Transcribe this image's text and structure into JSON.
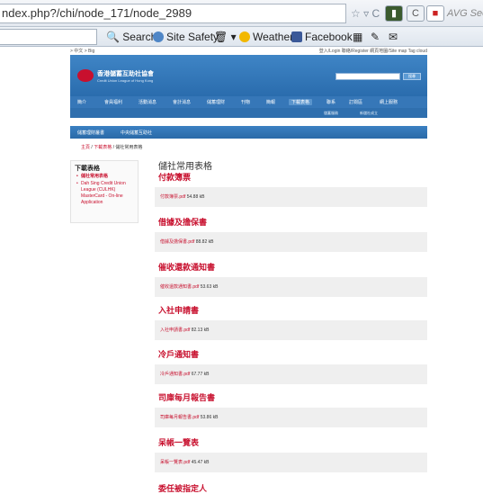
{
  "browser": {
    "url": "ndex.php?/chi/node_171/node_2989",
    "avg_label": "AVG Secu",
    "search_label": "Search",
    "toolbar": [
      {
        "label": "Site Safety",
        "icon": "site-safety-icon"
      },
      {
        "label": "Weather",
        "icon": "weather-icon"
      },
      {
        "label": "Facebook",
        "icon": "facebook-icon"
      }
    ]
  },
  "site": {
    "topline_left": "> 中文 > Big",
    "topline_right": "登入/Login   聯絡/Register   網頁地圖/Site map   Tag cloud",
    "logo_name": "香港儲蓄互助社協會",
    "logo_english": "Credit Union League of Hong Kong",
    "search_button": "搜尋",
    "nav": [
      "簡介",
      "會員福利",
      "活動消息",
      "會計消息",
      "儲蓄理財",
      "刊物",
      "簡報",
      "下載表格",
      "聯系",
      "訂閱區",
      "網上服務"
    ],
    "nav_active_index": 7,
    "subnav": [
      "儲蓄服務",
      "新儲社成立"
    ],
    "subnav2": [
      "儲蓄理財叢書",
      "中央儲蓄互助社"
    ],
    "breadcrumb": {
      "home": "主頁",
      "sep1": " / ",
      "mid": "下載表格",
      "sep2": " / ",
      "current": "儲社常用表格"
    }
  },
  "sidebar": {
    "title": "下載表格",
    "items": [
      {
        "label": "儲社常用表格",
        "current": true
      },
      {
        "label": "Dah Sing Credit Union League (CULHK) MasterCard - On-line Application",
        "current": false
      }
    ]
  },
  "main": {
    "page_title": "儲社常用表格",
    "sections": [
      {
        "heading": "付款簿票",
        "file": "付款簿票.pdf",
        "size": "54.88 kB"
      },
      {
        "heading": "借據及擔保書",
        "file": "借據及擔保書.pdf",
        "size": "88.82 kB"
      },
      {
        "heading": "催收還款通知書",
        "file": "催收還款通知書.pdf",
        "size": "53.63 kB"
      },
      {
        "heading": "入社申請書",
        "file": "入社申請書.pdf",
        "size": "82.13 kB"
      },
      {
        "heading": "冷戶通知書",
        "file": "冷戶通知書.pdf",
        "size": "67.77 kB"
      },
      {
        "heading": "司庫每月報告書",
        "file": "司庫每月報告書.pdf",
        "size": "53.86 kB"
      },
      {
        "heading": "呆帳一覽表",
        "file": "呆帳一覽表.pdf",
        "size": "45.47 kB"
      },
      {
        "heading": "委任被指定人",
        "file": "",
        "size": ""
      }
    ]
  }
}
